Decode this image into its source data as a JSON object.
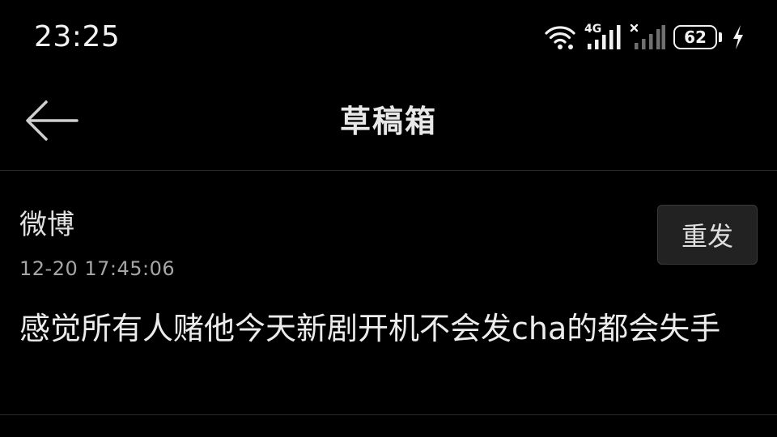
{
  "status_bar": {
    "time": "23:25",
    "network_label": "4G",
    "battery_level": "62",
    "icons": [
      "wifi-icon",
      "signal-4g-icon",
      "signal-no-service-icon",
      "battery-icon",
      "charging-bolt-icon"
    ]
  },
  "header": {
    "title": "草稿箱",
    "back_icon": "arrow-left-icon"
  },
  "drafts": [
    {
      "source": "微博",
      "timestamp": "12-20 17:45:06",
      "action_label": "重发",
      "content": "感觉所有人赌他今天新剧开机不会发cha的都会失手"
    }
  ],
  "colors": {
    "background": "#000000",
    "text_primary": "#ececec",
    "text_secondary": "#a6a6a6",
    "button_background": "#222222",
    "divider": "#2a2a2a"
  }
}
